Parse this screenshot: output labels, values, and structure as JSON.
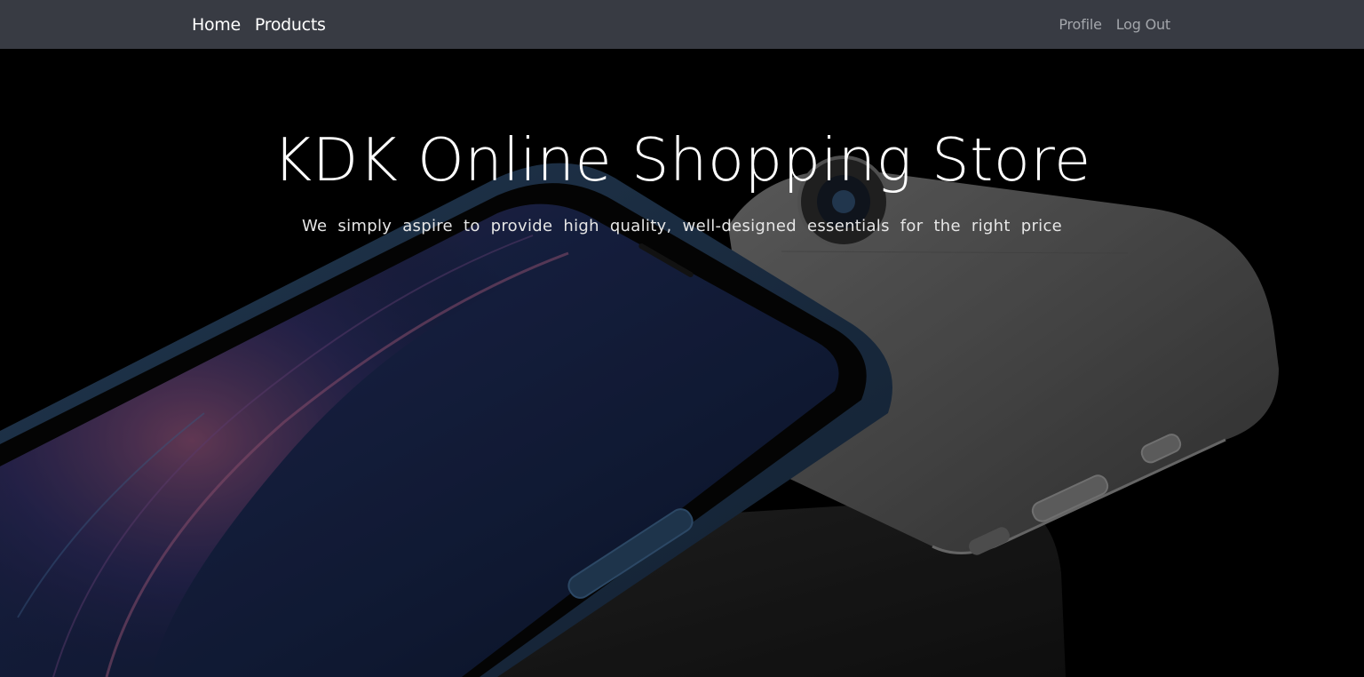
{
  "nav": {
    "home_label": "Home",
    "products_label": "Products",
    "profile_label": "Profile",
    "logout_label": "Log Out"
  },
  "hero": {
    "title": "KDK Online Shopping Store",
    "subtitle": "We simply aspire to provide high quality, well-designed essentials for the right price",
    "background_image": "phone-hero-image"
  },
  "colors": {
    "navbar_bg": "#383b43",
    "nav_primary_text": "#ffffff",
    "nav_secondary_text": "#a3a6ab",
    "hero_bg": "#000000"
  }
}
